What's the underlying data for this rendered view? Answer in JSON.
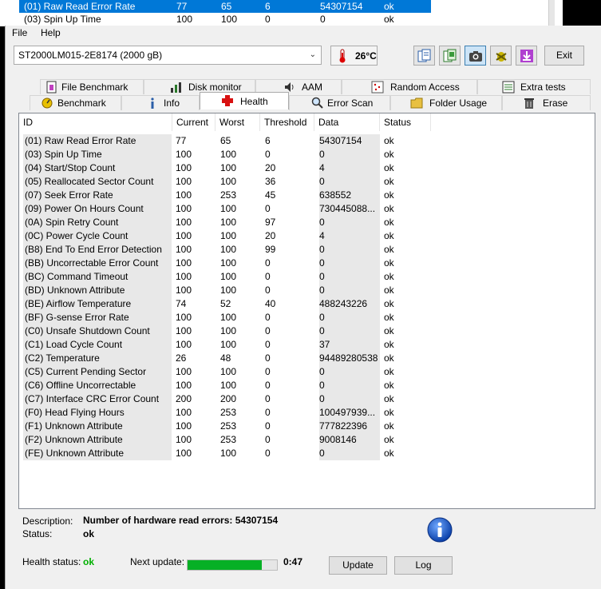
{
  "background_window": {
    "rows": [
      {
        "id": "(01) Raw Read Error Rate",
        "current": "77",
        "worst": "65",
        "threshold": "6",
        "data": "54307154",
        "status": "ok",
        "selected": true
      },
      {
        "id": "(03) Spin Up Time",
        "current": "100",
        "worst": "100",
        "threshold": "0",
        "data": "0",
        "status": "ok",
        "selected": false
      }
    ]
  },
  "menu": {
    "file": "File",
    "help": "Help"
  },
  "toolbar": {
    "drive": "ST2000LM015-2E8174 (2000 gB)",
    "temperature": "26°C",
    "exit_label": "Exit",
    "buttons": [
      "copy-text-icon",
      "copy-screenshot-icon",
      "camera-icon",
      "bug-icon",
      "download-icon"
    ]
  },
  "tabs": {
    "top": [
      "File Benchmark",
      "Disk monitor",
      "AAM",
      "Random Access",
      "Extra tests"
    ],
    "bottom": [
      "Benchmark",
      "Info",
      "Health",
      "Error Scan",
      "Folder Usage",
      "Erase"
    ],
    "active": "Health"
  },
  "table": {
    "headers": {
      "id": "ID",
      "current": "Current",
      "worst": "Worst",
      "threshold": "Threshold",
      "data": "Data",
      "status": "Status"
    },
    "rows": [
      {
        "id": "(01) Raw Read Error Rate",
        "current": "77",
        "worst": "65",
        "threshold": "6",
        "data": "54307154",
        "status": "ok"
      },
      {
        "id": "(03) Spin Up Time",
        "current": "100",
        "worst": "100",
        "threshold": "0",
        "data": "0",
        "status": "ok"
      },
      {
        "id": "(04) Start/Stop Count",
        "current": "100",
        "worst": "100",
        "threshold": "20",
        "data": "4",
        "status": "ok"
      },
      {
        "id": "(05) Reallocated Sector Count",
        "current": "100",
        "worst": "100",
        "threshold": "36",
        "data": "0",
        "status": "ok"
      },
      {
        "id": "(07) Seek Error Rate",
        "current": "100",
        "worst": "253",
        "threshold": "45",
        "data": "638552",
        "status": "ok"
      },
      {
        "id": "(09) Power On Hours Count",
        "current": "100",
        "worst": "100",
        "threshold": "0",
        "data": "730445088...",
        "status": "ok"
      },
      {
        "id": "(0A) Spin Retry Count",
        "current": "100",
        "worst": "100",
        "threshold": "97",
        "data": "0",
        "status": "ok"
      },
      {
        "id": "(0C) Power Cycle Count",
        "current": "100",
        "worst": "100",
        "threshold": "20",
        "data": "4",
        "status": "ok"
      },
      {
        "id": "(B8) End To End Error Detection",
        "current": "100",
        "worst": "100",
        "threshold": "99",
        "data": "0",
        "status": "ok"
      },
      {
        "id": "(BB) Uncorrectable Error Count",
        "current": "100",
        "worst": "100",
        "threshold": "0",
        "data": "0",
        "status": "ok"
      },
      {
        "id": "(BC) Command Timeout",
        "current": "100",
        "worst": "100",
        "threshold": "0",
        "data": "0",
        "status": "ok"
      },
      {
        "id": "(BD) Unknown Attribute",
        "current": "100",
        "worst": "100",
        "threshold": "0",
        "data": "0",
        "status": "ok"
      },
      {
        "id": "(BE) Airflow Temperature",
        "current": "74",
        "worst": "52",
        "threshold": "40",
        "data": "488243226",
        "status": "ok"
      },
      {
        "id": "(BF) G-sense Error Rate",
        "current": "100",
        "worst": "100",
        "threshold": "0",
        "data": "0",
        "status": "ok"
      },
      {
        "id": "(C0) Unsafe Shutdown Count",
        "current": "100",
        "worst": "100",
        "threshold": "0",
        "data": "0",
        "status": "ok"
      },
      {
        "id": "(C1) Load Cycle Count",
        "current": "100",
        "worst": "100",
        "threshold": "0",
        "data": "37",
        "status": "ok"
      },
      {
        "id": "(C2) Temperature",
        "current": "26",
        "worst": "48",
        "threshold": "0",
        "data": "94489280538",
        "status": "ok"
      },
      {
        "id": "(C5) Current Pending Sector",
        "current": "100",
        "worst": "100",
        "threshold": "0",
        "data": "0",
        "status": "ok"
      },
      {
        "id": "(C6) Offline Uncorrectable",
        "current": "100",
        "worst": "100",
        "threshold": "0",
        "data": "0",
        "status": "ok"
      },
      {
        "id": "(C7) Interface CRC Error Count",
        "current": "200",
        "worst": "200",
        "threshold": "0",
        "data": "0",
        "status": "ok"
      },
      {
        "id": "(F0) Head Flying Hours",
        "current": "100",
        "worst": "253",
        "threshold": "0",
        "data": "100497939...",
        "status": "ok"
      },
      {
        "id": "(F1) Unknown Attribute",
        "current": "100",
        "worst": "253",
        "threshold": "0",
        "data": "777822396",
        "status": "ok"
      },
      {
        "id": "(F2) Unknown Attribute",
        "current": "100",
        "worst": "253",
        "threshold": "0",
        "data": "9008146",
        "status": "ok"
      },
      {
        "id": "(FE) Unknown Attribute",
        "current": "100",
        "worst": "100",
        "threshold": "0",
        "data": "0",
        "status": "ok"
      }
    ]
  },
  "details": {
    "description_label": "Description:",
    "description_value": "Number of hardware read errors: 54307154",
    "status_label": "Status:",
    "status_value": "ok"
  },
  "footer": {
    "health_label": "Health status:",
    "health_value": "ok",
    "health_color": "#00b000",
    "next_update_label": "Next update:",
    "progress_fraction": 0.83,
    "countdown": "0:47",
    "update_label": "Update",
    "log_label": "Log"
  }
}
